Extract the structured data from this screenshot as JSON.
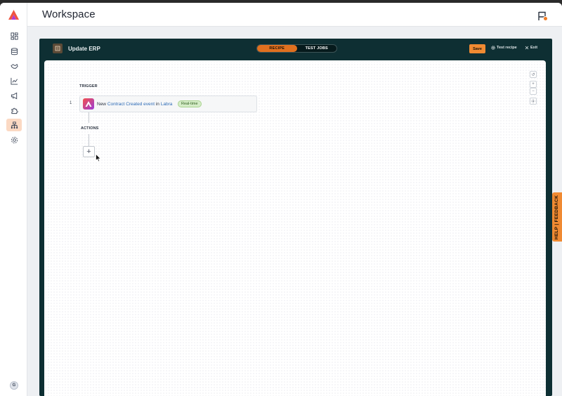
{
  "header": {
    "title": "Workspace"
  },
  "sidebar": {
    "items": [
      {
        "name": "dashboard"
      },
      {
        "name": "database"
      },
      {
        "name": "integrations"
      },
      {
        "name": "analytics"
      },
      {
        "name": "campaigns"
      },
      {
        "name": "plugins"
      },
      {
        "name": "workflows",
        "active": true
      },
      {
        "name": "settings"
      }
    ],
    "avatar_initial": "G"
  },
  "editor": {
    "recipe_name": "Update ERP",
    "tabs": [
      {
        "label": "RECIPE",
        "active": true
      },
      {
        "label": "TEST JOBS",
        "active": false
      }
    ],
    "save_label": "Save",
    "test_label": "Test recipe",
    "exit_label": "Exit"
  },
  "canvas": {
    "trigger_heading": "TRIGGER",
    "step_number": "1",
    "trigger": {
      "prefix": "New",
      "event": "Contract Created event",
      "connector_word": "in",
      "app": "Labra",
      "badge": "Real-time"
    },
    "actions_heading": "ACTIONS",
    "add_symbol": "+"
  },
  "feedback": {
    "label": "HELP | FEEDBACK"
  },
  "colors": {
    "accent": "#f08a32",
    "editor_bg": "#0e2f33",
    "active_nav": "#fbd9c3",
    "link": "#2d6bb6"
  }
}
